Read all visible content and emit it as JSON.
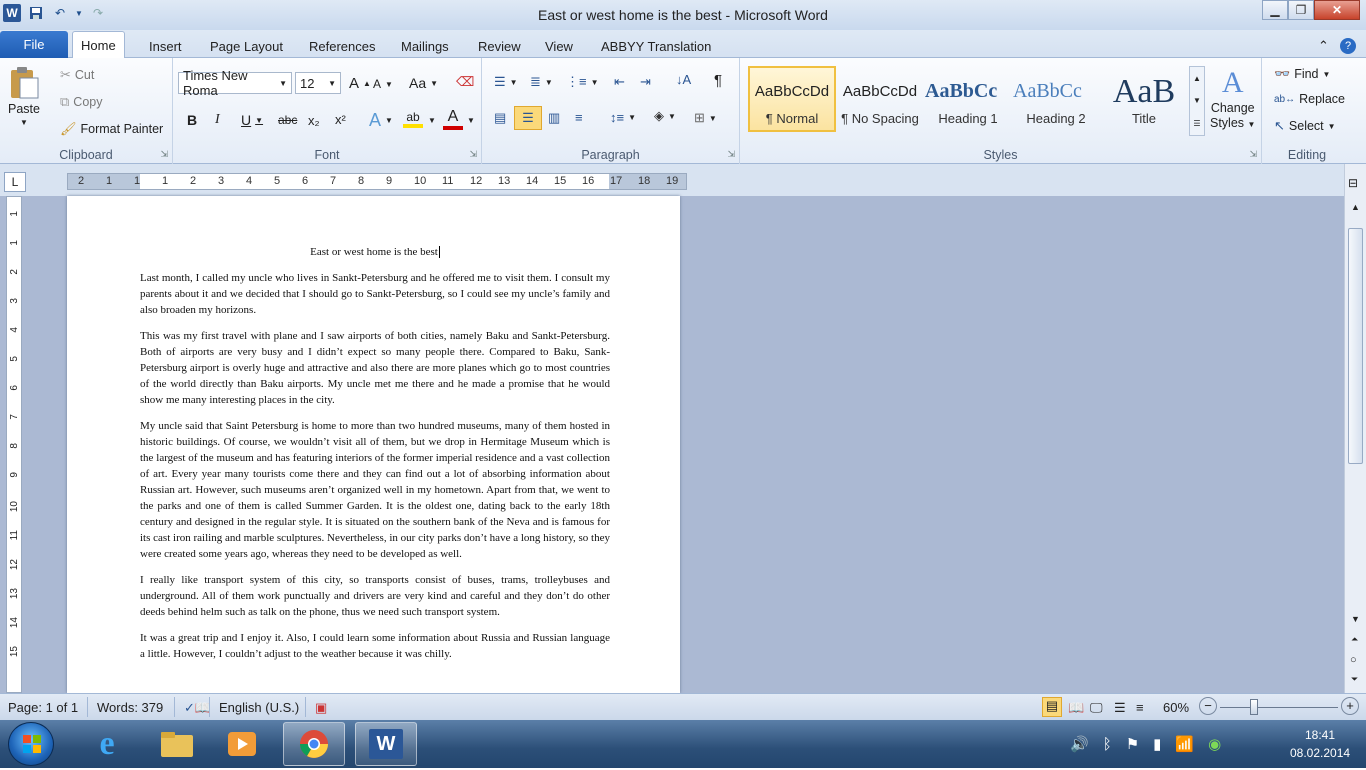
{
  "window": {
    "title": "East or west home is the best - Microsoft Word"
  },
  "quick_access": {
    "icons": [
      "word-logo-icon",
      "save-icon",
      "undo-icon",
      "redo-icon"
    ]
  },
  "tabs": {
    "file": "File",
    "items": [
      "Home",
      "Insert",
      "Page Layout",
      "References",
      "Mailings",
      "Review",
      "View",
      "ABBYY Translation"
    ],
    "active": "Home"
  },
  "clipboard": {
    "paste": "Paste",
    "cut": "Cut",
    "copy": "Copy",
    "format_painter": "Format Painter",
    "label": "Clipboard"
  },
  "font": {
    "name": "Times New Roma",
    "size": "12",
    "label": "Font",
    "grow": "A",
    "shrink": "A",
    "case": "Aa",
    "bold": "B",
    "italic": "I",
    "underline": "U",
    "strike": "abc",
    "sub": "x₂",
    "sup": "x²",
    "effects": "A",
    "highlight": "ab",
    "color": "A"
  },
  "paragraph": {
    "label": "Paragraph",
    "show_marks": "¶"
  },
  "styles": {
    "label": "Styles",
    "items": [
      {
        "sample": "AaBbCcDd",
        "name": "¶ Normal"
      },
      {
        "sample": "AaBbCcDd",
        "name": "¶ No Spacing"
      },
      {
        "sample": "AaBbCc",
        "name": "Heading 1"
      },
      {
        "sample": "AaBbCc",
        "name": "Heading 2"
      },
      {
        "sample": "AaB",
        "name": "Title"
      }
    ],
    "change_styles_line1": "Change",
    "change_styles_line2": "Styles"
  },
  "editing": {
    "label": "Editing",
    "find": "Find",
    "replace": "Replace",
    "select": "Select"
  },
  "ruler": {
    "tab_selector": "L",
    "h_marks": [
      "2",
      "1",
      "1",
      "1",
      "2",
      "3",
      "4",
      "5",
      "6",
      "7",
      "8",
      "9",
      "10",
      "11",
      "12",
      "13",
      "14",
      "15",
      "16",
      "17",
      "18",
      "19"
    ],
    "v_marks": [
      "1",
      "1",
      "2",
      "3",
      "4",
      "5",
      "6",
      "7",
      "8",
      "9",
      "10",
      "11",
      "12",
      "13",
      "14",
      "15"
    ]
  },
  "document": {
    "title": "East or west home is the best",
    "paragraphs": [
      "Last month, I called my uncle who lives in Sankt-Petersburg and he offered me to visit them. I consult my parents about it and we decided that I should go to Sankt-Petersburg, so I could see my uncle’s family and also broaden my horizons.",
      "This was my first travel with plane and I saw airports of both cities, namely Baku and Sankt-Petersburg. Both of airports are very busy and I didn’t expect so many people there. Compared to Baku, Sank-Petersburg airport is overly huge and attractive and also there are more planes which go to most countries of the world directly than Baku airports. My uncle met me there and he made a promise that he would show me many interesting places in the city.",
      "My uncle said that Saint Petersburg is home to more than two hundred museums, many of them hosted in historic buildings. Of course, we wouldn’t visit all of them, but we drop in Hermitage Museum which is the largest of the museum and has featuring interiors of the former imperial residence and a vast collection of art. Every year many tourists come there and they can find out a lot of absorbing information about Russian art. However, such museums aren’t organized well in my hometown. Apart from that, we went to the parks and one of them is called Summer Garden. It is the oldest one, dating back to the early 18th century and designed in the regular style. It is situated on the southern bank of the Neva and is famous for its cast iron railing and marble sculptures. Nevertheless, in our city parks don’t have a long history, so they were created some years ago, whereas they need to be developed as well.",
      "I really like transport system of this city, so transports consist of buses, trams, trolleybuses and underground. All of them work punctually and drivers are very kind and careful and they don’t do other deeds behind helm such as talk on the phone, thus we need such transport system.",
      "It was a great trip and I enjoy it. Also, I could learn some information about Russia and Russian language a little. However, I couldn’t adjust to the weather because it was chilly."
    ]
  },
  "status": {
    "page": "Page: 1 of 1",
    "words": "Words: 379",
    "language": "English (U.S.)",
    "zoom": "60%",
    "zoom_minus": "−",
    "zoom_plus": "+"
  },
  "taskbar": {
    "time": "18:41",
    "date": "08.02.2014",
    "apps": [
      "internet-explorer-icon",
      "file-explorer-icon",
      "media-player-icon",
      "chrome-icon",
      "word-icon"
    ]
  },
  "colors": {
    "accent": "#2b5797",
    "file_tab": "#2a6bc4",
    "highlight": "#ffe000",
    "font_color": "#d00000"
  }
}
